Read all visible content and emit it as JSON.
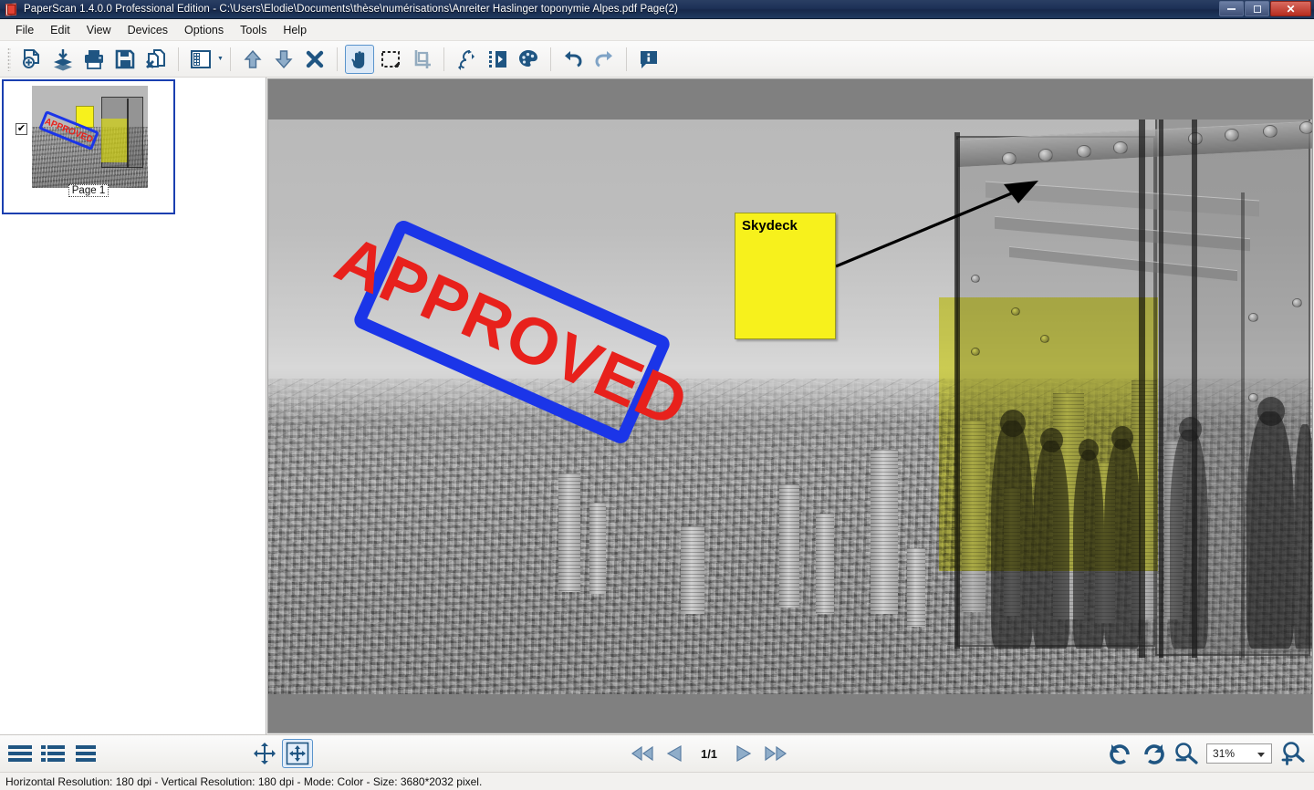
{
  "window": {
    "title": "PaperScan 1.4.0.0 Professional Edition - C:\\Users\\Elodie\\Documents\\thèse\\numérisations\\Anreiter Haslinger toponymie Alpes.pdf Page(2)",
    "app_icon": "paperscan-app-icon",
    "controls": [
      {
        "name": "minimize-button",
        "glyph": "minimize-icon"
      },
      {
        "name": "maximize-button",
        "glyph": "maximize-icon"
      },
      {
        "name": "close-button",
        "glyph": "close-icon",
        "label": "✕"
      }
    ]
  },
  "menubar": {
    "items": [
      {
        "label": "File",
        "name": "menu-file"
      },
      {
        "label": "Edit",
        "name": "menu-edit"
      },
      {
        "label": "View",
        "name": "menu-view"
      },
      {
        "label": "Devices",
        "name": "menu-devices"
      },
      {
        "label": "Options",
        "name": "menu-options"
      },
      {
        "label": "Tools",
        "name": "menu-tools"
      },
      {
        "label": "Help",
        "name": "menu-help"
      }
    ]
  },
  "toolbar": {
    "buttons": [
      {
        "name": "acquire-new-document-icon",
        "tip": "Acquire new document"
      },
      {
        "name": "import-layers-icon",
        "tip": "Import"
      },
      {
        "name": "print-icon",
        "tip": "Print"
      },
      {
        "name": "save-icon",
        "tip": "Save"
      },
      {
        "name": "delete-document-icon",
        "tip": "Close document"
      },
      {
        "name": "layout-view-icon",
        "tip": "Layout",
        "has_dropdown": true
      },
      {
        "name": "move-up-icon",
        "tip": "Move page up"
      },
      {
        "name": "move-down-icon",
        "tip": "Move page down"
      },
      {
        "name": "delete-page-icon",
        "tip": "Delete page"
      },
      {
        "name": "hand-pan-tool-icon",
        "tip": "Pan tool",
        "active": true
      },
      {
        "name": "rectangle-select-tool-icon",
        "tip": "Select region"
      },
      {
        "name": "crop-tool-icon",
        "tip": "Crop",
        "disabled": true
      },
      {
        "name": "deskew-rotate-icon",
        "tip": "Rotate / deskew"
      },
      {
        "name": "page-effects-icon",
        "tip": "Page processing"
      },
      {
        "name": "color-palette-icon",
        "tip": "Color adjustments"
      },
      {
        "name": "undo-icon",
        "tip": "Undo"
      },
      {
        "name": "redo-icon",
        "tip": "Redo"
      },
      {
        "name": "annotation-info-icon",
        "tip": "Annotations"
      }
    ]
  },
  "thumbnails": {
    "pages": [
      {
        "label": "Page 1",
        "checked": true,
        "selected": true,
        "check_glyph": "✔"
      }
    ]
  },
  "document": {
    "annotations": {
      "note": {
        "text": "Skydeck",
        "fill_color": "#f7f11c",
        "border_color": "#9a9a20"
      },
      "arrow": {
        "name": "arrow-annotation",
        "color": "#000000"
      },
      "stamp": {
        "text": "APPROVED",
        "text_color": "#e8211c",
        "border_color": "#1b35e8",
        "rotation_deg": 24
      },
      "highlight": {
        "name": "yellow-highlight-annotation",
        "color": "#e6e600"
      }
    }
  },
  "bottombar": {
    "view_modes": [
      {
        "name": "view-mode-list-icon"
      },
      {
        "name": "view-mode-details-icon"
      },
      {
        "name": "view-mode-thumbnails-icon"
      }
    ],
    "fit_buttons": [
      {
        "name": "fit-actual-size-icon"
      },
      {
        "name": "fit-to-window-icon",
        "active": true
      }
    ],
    "navigation": {
      "first": "first-page-icon",
      "previous": "previous-page-icon",
      "page_indicator": "1/1",
      "next": "next-page-icon",
      "last": "last-page-icon"
    },
    "rotation": {
      "rotate_left": "rotate-left-icon",
      "rotate_right": "rotate-right-icon"
    },
    "zoom": {
      "zoom_out": "zoom-out-icon",
      "value": "31%",
      "zoom_in": "zoom-in-icon"
    }
  },
  "statusbar": {
    "text": "Horizontal Resolution:  180 dpi - Vertical Resolution:  180 dpi - Mode: Color - Size: 3680*2032 pixel."
  },
  "colors": {
    "accent_blue": "#1f5582",
    "titlebar_blue": "#1d3157",
    "canvas_gray": "#808080",
    "stamp_blue": "#1b35e8",
    "stamp_red": "#e8211c",
    "note_yellow": "#f7f11c"
  }
}
